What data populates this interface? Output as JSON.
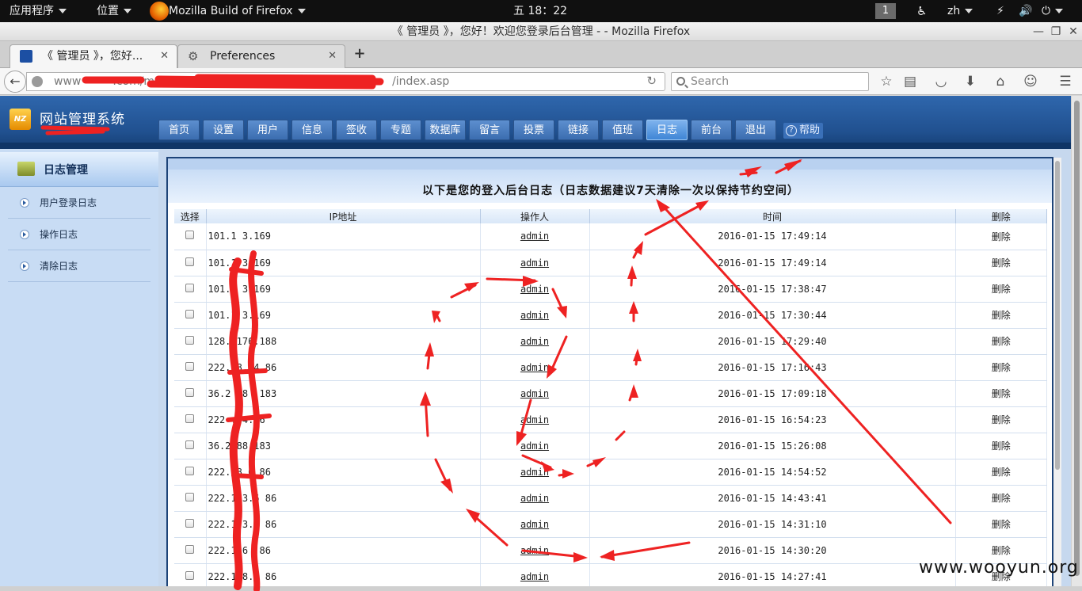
{
  "desktop": {
    "applications_menu": "应用程序",
    "places_menu": "位置",
    "active_app": "Mozilla Build of Firefox",
    "clock": "五 18：22",
    "workspace": "1",
    "language": "zh"
  },
  "window": {
    "title": "《 管理员 》，您好！欢迎您登录后台管理 - - Mozilla Firefox"
  },
  "tabs": [
    {
      "label": "《 管理员 》，您好...",
      "active": true
    },
    {
      "label": "Preferences",
      "active": false
    }
  ],
  "navbar": {
    "url_prefix": "www",
    "url_mid": ".com/m",
    "url_suffix": "/index.asp",
    "search_placeholder": "Search"
  },
  "site": {
    "logo_text": "NZ",
    "title": "网站管理系统",
    "nav": [
      "首页",
      "设置",
      "用户",
      "信息",
      "签收",
      "专题",
      "数据库",
      "留言",
      "投票",
      "链接",
      "值班",
      "日志",
      "前台",
      "退出"
    ],
    "nav_active": "日志",
    "help": "帮助"
  },
  "sidebar": {
    "heading": "日志管理",
    "items": [
      {
        "label": "用户登录日志"
      },
      {
        "label": "操作日志"
      },
      {
        "label": "清除日志"
      }
    ]
  },
  "log": {
    "title": "以下是您的登入后台日志（日志数据建议7天清除一次以保持节约空间）",
    "columns": [
      "选择",
      "IP地址",
      "操作人",
      "时间",
      "删除"
    ],
    "rows": [
      {
        "ip": "101.1   3.169",
        "user": "admin",
        "time": "2016-01-15 17:49:14",
        "del": "删除"
      },
      {
        "ip": "101.1   3.169",
        "user": "admin",
        "time": "2016-01-15 17:49:14",
        "del": "删除"
      },
      {
        "ip": "101.1   3.169",
        "user": "admin",
        "time": "2016-01-15 17:38:47",
        "del": "删除"
      },
      {
        "ip": "101.1   3.169",
        "user": "admin",
        "time": "2016-01-15 17:30:44",
        "del": "删除"
      },
      {
        "ip": "128.   176.188",
        "user": "admin",
        "time": "2016-01-15 17:29:40",
        "del": "删除"
      },
      {
        "ip": "222.   8.  4.86",
        "user": "admin",
        "time": "2016-01-15 17:16:43",
        "del": "删除"
      },
      {
        "ip": "36.2  .8   .183",
        "user": "admin",
        "time": "2016-01-15 17:09:18",
        "del": "删除"
      },
      {
        "ip": "222    .  4.86",
        "user": "admin",
        "time": "2016-01-15 16:54:23",
        "del": "删除"
      },
      {
        "ip": "36.2   88.183",
        "user": "admin",
        "time": "2016-01-15 15:26:08",
        "del": "删除"
      },
      {
        "ip": "222.  8.6  86",
        "user": "admin",
        "time": "2016-01-15 14:54:52",
        "del": "删除"
      },
      {
        "ip": "222.1  3.6  86",
        "user": "admin",
        "time": "2016-01-15 14:43:41",
        "del": "删除"
      },
      {
        "ip": "222.1  3.6  86",
        "user": "admin",
        "time": "2016-01-15 14:31:10",
        "del": "删除"
      },
      {
        "ip": "222.1   6  .86",
        "user": "admin",
        "time": "2016-01-15 14:30:20",
        "del": "删除"
      },
      {
        "ip": "222.1  8.6  86",
        "user": "admin",
        "time": "2016-01-15 14:27:41",
        "del": "删除"
      }
    ]
  },
  "watermark": "www.wooyun.org",
  "colors": {
    "header_blue": "#20508f",
    "nav_active": "#3f86d6",
    "sidebar_bg": "#c8dcf4",
    "annotation_red": "#ee2222"
  }
}
